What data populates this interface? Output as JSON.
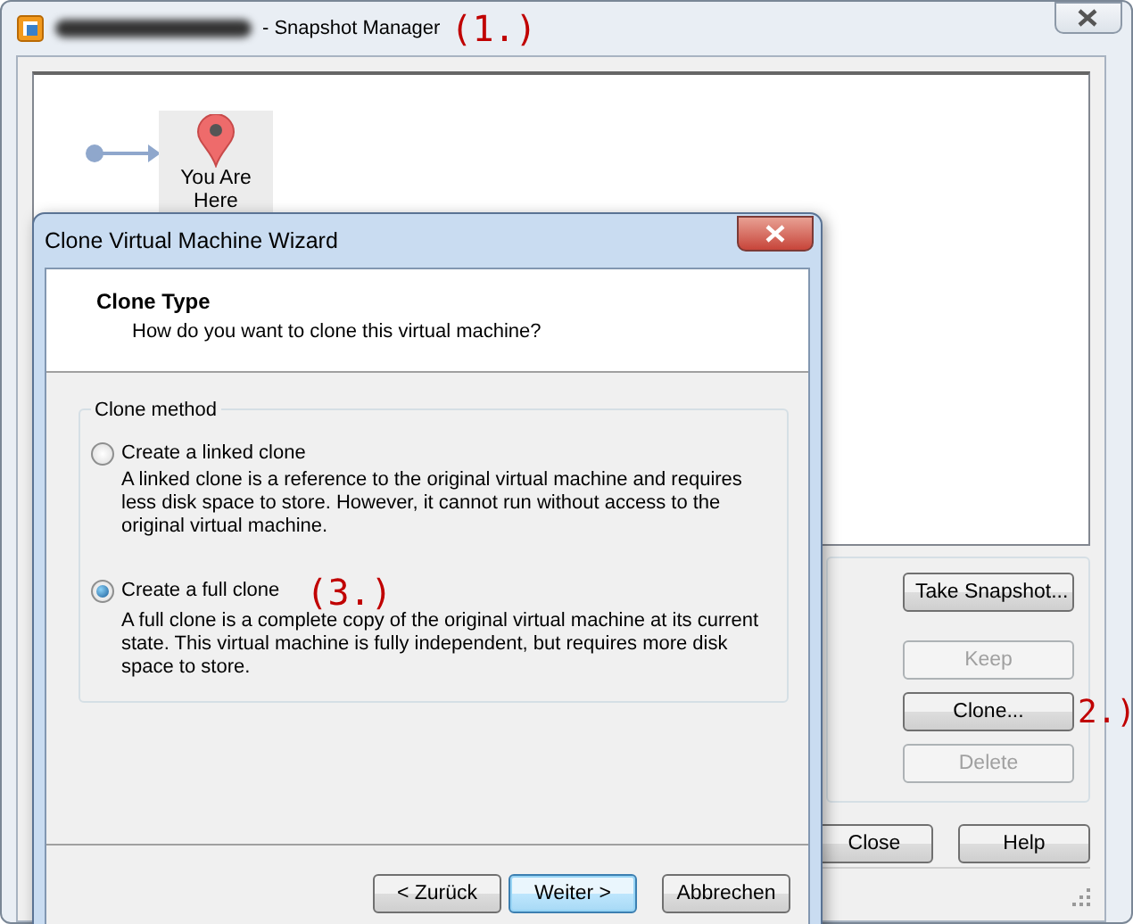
{
  "main_window": {
    "title": "- Snapshot Manager",
    "annotation": "(1.)",
    "snapshot_tree": {
      "current_state_label": "You Are Here"
    },
    "buttons": [
      {
        "label": "Take Snapshot...",
        "disabled": false
      },
      {
        "label": "Keep",
        "disabled": true
      },
      {
        "label": "Clone...",
        "disabled": false,
        "annotation": "2.)"
      },
      {
        "label": "Delete",
        "disabled": true
      }
    ],
    "footer_buttons": [
      "Close",
      "Help"
    ]
  },
  "dialog": {
    "title": "Clone Virtual Machine Wizard",
    "header_title": "Clone Type",
    "header_subtitle": "How do you want to clone this virtual machine?",
    "group_label": "Clone method",
    "options": [
      {
        "label": "Create a linked clone",
        "description": "A linked clone is a reference to the original virtual machine and requires less disk space to store. However, it cannot run without access to the original virtual machine.",
        "selected": false
      },
      {
        "label": "Create a full clone",
        "description": "A full clone is a complete copy of the original virtual machine at its current state. This virtual machine is fully independent, but requires more disk space to store.",
        "selected": true,
        "annotation": "(3.)"
      }
    ],
    "buttons": [
      {
        "label": "< Zurück",
        "default": false
      },
      {
        "label": "Weiter >",
        "default": true
      },
      {
        "label": "Abbrechen",
        "default": false
      }
    ]
  }
}
